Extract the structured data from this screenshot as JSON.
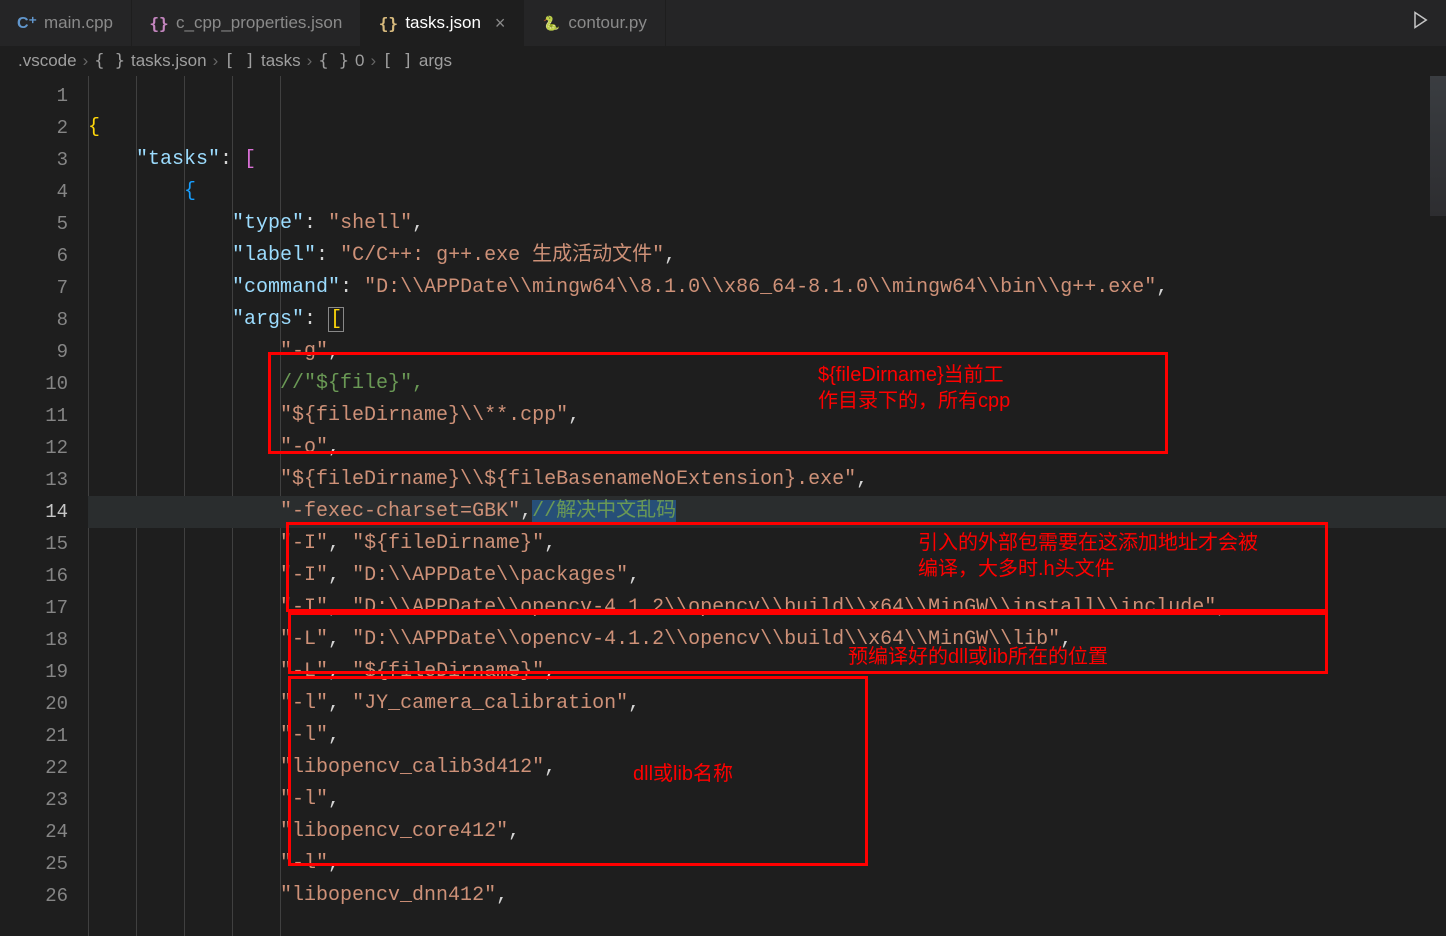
{
  "tabs": [
    {
      "label": "main.cpp",
      "icon": "cpp",
      "active": false
    },
    {
      "label": "c_cpp_properties.json",
      "icon": "braces",
      "active": false
    },
    {
      "label": "tasks.json",
      "icon": "braces",
      "active": true,
      "close": "×"
    },
    {
      "label": "contour.py",
      "icon": "python",
      "active": false
    }
  ],
  "breadcrumb": {
    "root": ".vscode",
    "file": "tasks.json",
    "seg1": "tasks",
    "seg2": "0",
    "seg3": "args",
    "file_ic": "{ }",
    "arr_ic": "[  ]",
    "obj_ic": "{ }"
  },
  "line_nums": [
    "1",
    "2",
    "3",
    "4",
    "5",
    "6",
    "7",
    "8",
    "9",
    "10",
    "11",
    "12",
    "13",
    "14",
    "15",
    "16",
    "17",
    "18",
    "19",
    "20",
    "21",
    "22",
    "23",
    "24",
    "25",
    "26"
  ],
  "current_line": 14,
  "code": {
    "l2": "{",
    "l3_key": "\"tasks\"",
    "l3_col": ": ",
    "l3_br": "[",
    "l4": "{",
    "l5_key": "\"type\"",
    "l5_col": ": ",
    "l5_val": "\"shell\"",
    "l5_cm": ",",
    "l6_key": "\"label\"",
    "l6_col": ": ",
    "l6_val": "\"C/C++: g++.exe 生成活动文件\"",
    "l6_cm": ",",
    "l7_key": "\"command\"",
    "l7_col": ": ",
    "l7_val": "\"D:\\\\APPDate\\\\mingw64\\\\8.1.0\\\\x86_64-8.1.0\\\\mingw64\\\\bin\\\\g++.exe\"",
    "l7_cm": ",",
    "l8_key": "\"args\"",
    "l8_col": ": ",
    "l8_br": "[",
    "l9": "\"-g\"",
    "l9_cm": ",",
    "l10_a": "//",
    "l10_b": "\"${file}\",",
    "l11": "\"${fileDirname}\\\\**.cpp\"",
    "l11_cm": ",",
    "l12": "\"-o\"",
    "l12_cm": ",",
    "l13": "\"${fileDirname}\\\\${fileBasenameNoExtension}.exe\"",
    "l13_cm": ",",
    "l14": "\"-fexec-charset=GBK\"",
    "l14_cm": ",",
    "l14_cmt": "//解决中文乱码",
    "l15a": "\"-I\"",
    "l15b": "\"${fileDirname}\"",
    "cm": ", ",
    "tcm": ",",
    "l16a": "\"-I\"",
    "l16b": "\"D:\\\\APPDate\\\\packages\"",
    "l17a": "\"-I\"",
    "l17b": "\"D:\\\\APPDate\\\\opencv-4.1.2\\\\opencv\\\\build\\\\x64\\\\MinGW\\\\install\\\\include\"",
    "l18a": "\"-L\"",
    "l18b": "\"D:\\\\APPDate\\\\opencv-4.1.2\\\\opencv\\\\build\\\\x64\\\\MinGW\\\\lib\"",
    "l19a": "\"-L\"",
    "l19b": "\"${fileDirname}\"",
    "l20a": "\"-l\"",
    "l20b": "\"JY_camera_calibration\"",
    "l21": "\"-l\"",
    "l22": "\"libopencv_calib3d412\"",
    "l23": "\"-l\"",
    "l24": "\"libopencv_core412\"",
    "l25": "\"-l\"",
    "l26": "\"libopencv_dnn412\""
  },
  "annotations": {
    "a1_l1": "${fileDirname}当前工",
    "a1_l2": "作目录下的，所有cpp",
    "a2_l1": "引入的外部包需要在这添加地址才会被",
    "a2_l2": "编译，大多时.h头文件",
    "a3": "预编译好的dll或lib所在的位置",
    "a4": "dll或lib名称"
  }
}
